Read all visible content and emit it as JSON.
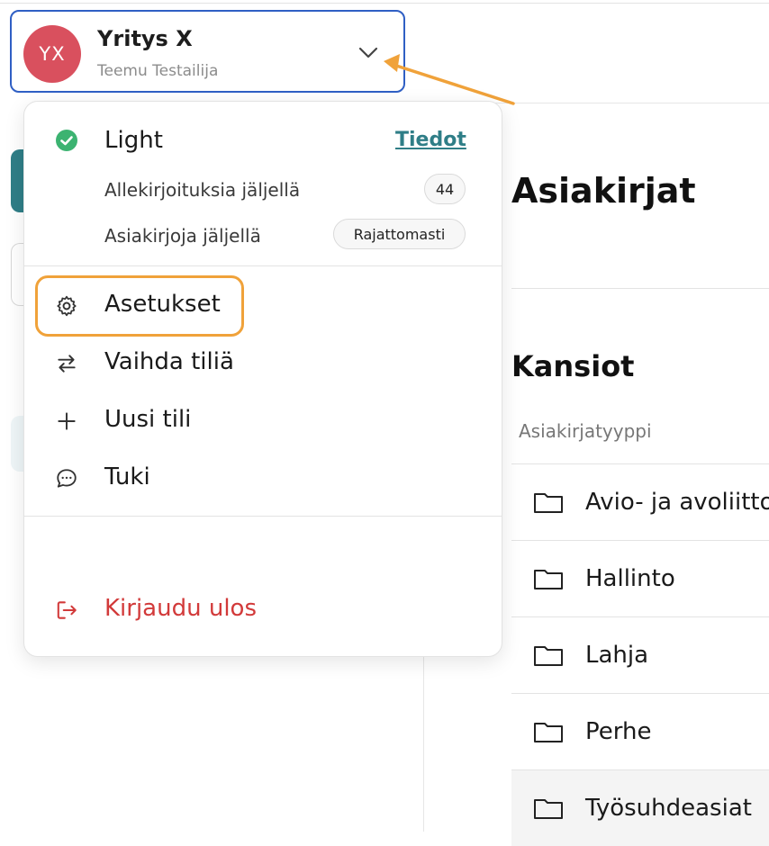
{
  "account": {
    "avatar_initials": "YX",
    "avatar_color": "#d9505e",
    "name": "Yritys X",
    "user": "Teemu Testailija",
    "border_color": "#2f5fc4"
  },
  "menu": {
    "plan": {
      "name": "Light",
      "details_link": "Tiedot",
      "status_icon": "check-circle-icon",
      "status_color": "#3cb371"
    },
    "quotas": [
      {
        "label": "Allekirjoituksia jäljellä",
        "value": "44"
      },
      {
        "label": "Asiakirjoja jäljellä",
        "value": "Rajattomasti"
      }
    ],
    "items": [
      {
        "label": "Asetukset",
        "icon": "gear-icon"
      },
      {
        "label": "Vaihda tiliä",
        "icon": "swap-arrows-icon"
      },
      {
        "label": "Uusi tili",
        "icon": "plus-icon"
      },
      {
        "label": "Tuki",
        "icon": "chat-bubble-icon"
      }
    ],
    "logout": {
      "label": "Kirjaudu ulos",
      "icon": "logout-icon",
      "color": "#d23a3a"
    }
  },
  "main": {
    "title": "Asiakirjat",
    "section_title": "Kansiot",
    "column_header": "Asiakirjatyyppi",
    "folders": [
      "Avio- ja avoliitto",
      "Hallinto",
      "Lahja",
      "Perhe",
      "Työsuhdeasiat"
    ]
  },
  "colors": {
    "accent": "#2f7e87",
    "annotation": "#f0a23a"
  }
}
